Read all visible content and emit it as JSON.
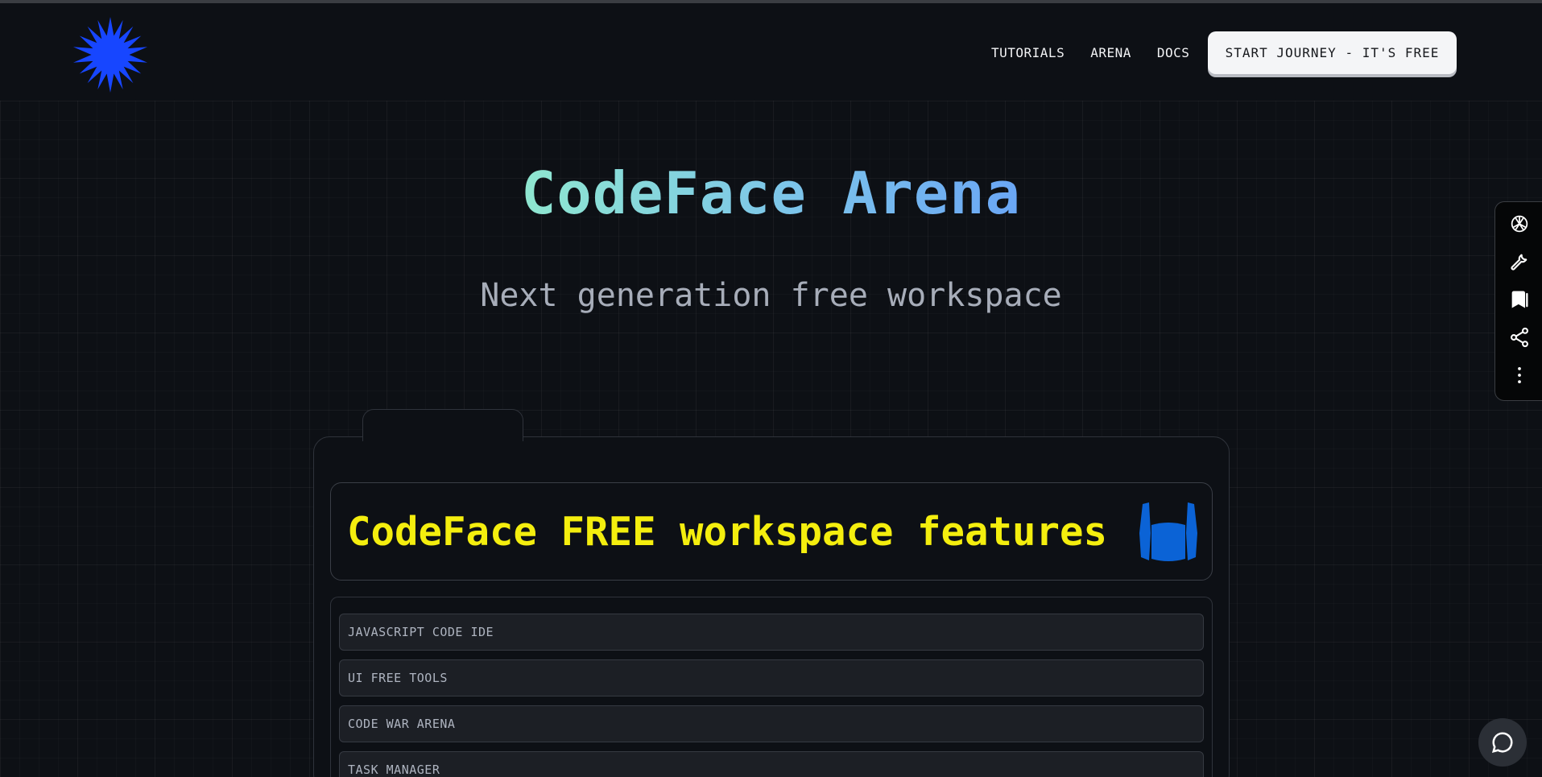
{
  "header": {
    "logo_name": "starburst-logo",
    "nav": [
      {
        "label": "TUTORIALS"
      },
      {
        "label": "ARENA"
      },
      {
        "label": "DOCS"
      }
    ],
    "cta_label": "START JOURNEY - IT'S FREE"
  },
  "hero": {
    "title": "CodeFace Arena",
    "subtitle": "Next generation free workspace"
  },
  "features": {
    "title": "CodeFace FREE workspace features",
    "items": [
      {
        "label": "JAVASCRIPT CODE IDE"
      },
      {
        "label": "UI FREE TOOLS"
      },
      {
        "label": "CODE WAR ARENA"
      },
      {
        "label": "TASK MANAGER"
      }
    ]
  },
  "side_toolbar": {
    "icons": [
      "openai-icon",
      "wrench-icon",
      "bookmark-icon",
      "share-icon",
      "more-vertical-icon"
    ]
  },
  "chat": {
    "icon": "chat-bubble-icon"
  },
  "colors": {
    "background": "#0d1015",
    "logo_blue": "#1746ff",
    "features_title_yellow": "#f4ee0e",
    "hero_gradient_start": "#8fe7d0",
    "hero_gradient_end": "#6aa6f5",
    "box_icon_blue": "#0b63d6"
  }
}
